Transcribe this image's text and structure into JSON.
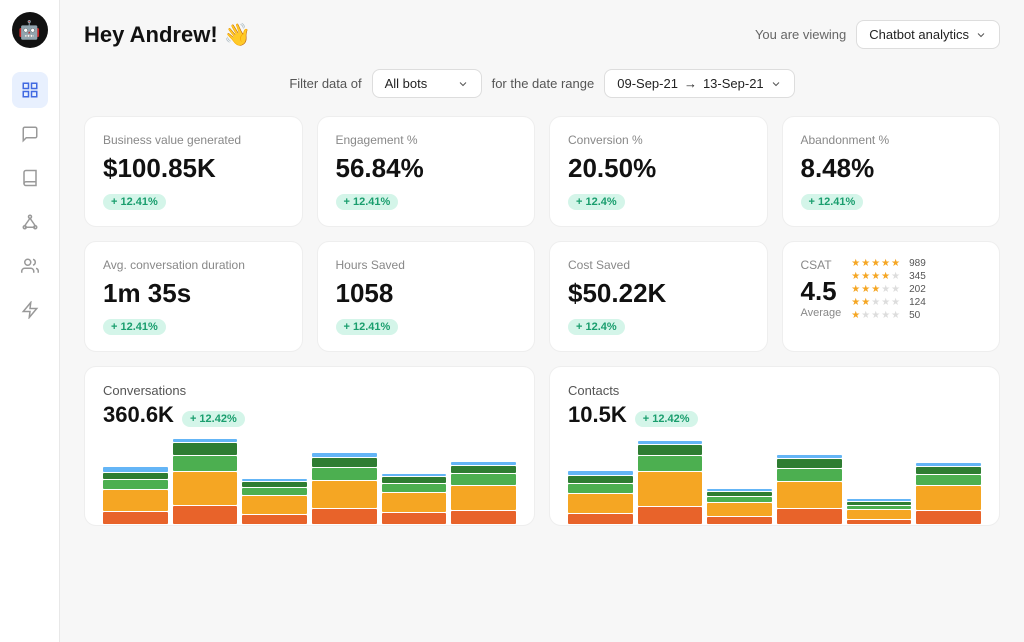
{
  "sidebar": {
    "logo": "🤖",
    "items": [
      {
        "id": "analytics",
        "icon": "📊",
        "active": true
      },
      {
        "id": "chat",
        "icon": "💬",
        "active": false
      },
      {
        "id": "book",
        "icon": "📖",
        "active": false
      },
      {
        "id": "network",
        "icon": "🕸️",
        "active": false
      },
      {
        "id": "users",
        "icon": "👥",
        "active": false
      },
      {
        "id": "filter",
        "icon": "⚡",
        "active": false
      }
    ]
  },
  "header": {
    "title": "Hey Andrew! 👋",
    "viewing_label": "You are viewing",
    "viewing_value": "Chatbot analytics",
    "chevron": "∨"
  },
  "filter": {
    "label1": "Filter data of",
    "bot_value": "All bots",
    "label2": "for the date range",
    "date_from": "09-Sep-21",
    "arrow": "→",
    "date_to": "13-Sep-21"
  },
  "kpi_row1": [
    {
      "label": "Business value generated",
      "value": "$100.85K",
      "badge": "+ 12.41%"
    },
    {
      "label": "Engagement %",
      "value": "56.84%",
      "badge": "+ 12.41%"
    },
    {
      "label": "Conversion %",
      "value": "20.50%",
      "badge": "+ 12.4%"
    },
    {
      "label": "Abandonment %",
      "value": "8.48%",
      "badge": "+ 12.41%"
    }
  ],
  "kpi_row2": [
    {
      "label": "Avg. conversation duration",
      "value": "1m 35s",
      "badge": "+ 12.41%"
    },
    {
      "label": "Hours Saved",
      "value": "1058",
      "badge": "+ 12.41%"
    },
    {
      "label": "Cost Saved",
      "value": "$50.22K",
      "badge": "+ 12.4%"
    }
  ],
  "csat": {
    "label": "CSAT",
    "score": "4.5",
    "avg_label": "Average",
    "rows": [
      {
        "stars": 5,
        "count": "989"
      },
      {
        "stars": 4,
        "count": "345"
      },
      {
        "stars": 3,
        "count": "202"
      },
      {
        "stars": 2,
        "count": "124"
      },
      {
        "stars": 1,
        "count": "50"
      }
    ]
  },
  "charts": [
    {
      "title": "Conversations",
      "value": "360.6K",
      "badge": "+ 12.42%",
      "bars": [
        [
          20,
          35,
          15,
          10,
          8
        ],
        [
          30,
          55,
          25,
          20,
          5
        ],
        [
          15,
          30,
          12,
          8,
          3
        ],
        [
          25,
          45,
          20,
          15,
          6
        ],
        [
          18,
          32,
          14,
          10,
          4
        ],
        [
          22,
          40,
          18,
          12,
          5
        ]
      ]
    },
    {
      "title": "Contacts",
      "value": "10.5K",
      "badge": "+ 12.42%",
      "bars": [
        [
          12,
          22,
          10,
          8,
          5
        ],
        [
          20,
          40,
          18,
          12,
          3
        ],
        [
          8,
          15,
          6,
          5,
          2
        ],
        [
          18,
          30,
          14,
          10,
          4
        ],
        [
          5,
          10,
          4,
          3,
          2
        ],
        [
          15,
          28,
          12,
          8,
          3
        ]
      ]
    }
  ],
  "bar_colors": [
    "#e8632a",
    "#f5a623",
    "#4caf50",
    "#2e7d32",
    "#64b5f6"
  ]
}
